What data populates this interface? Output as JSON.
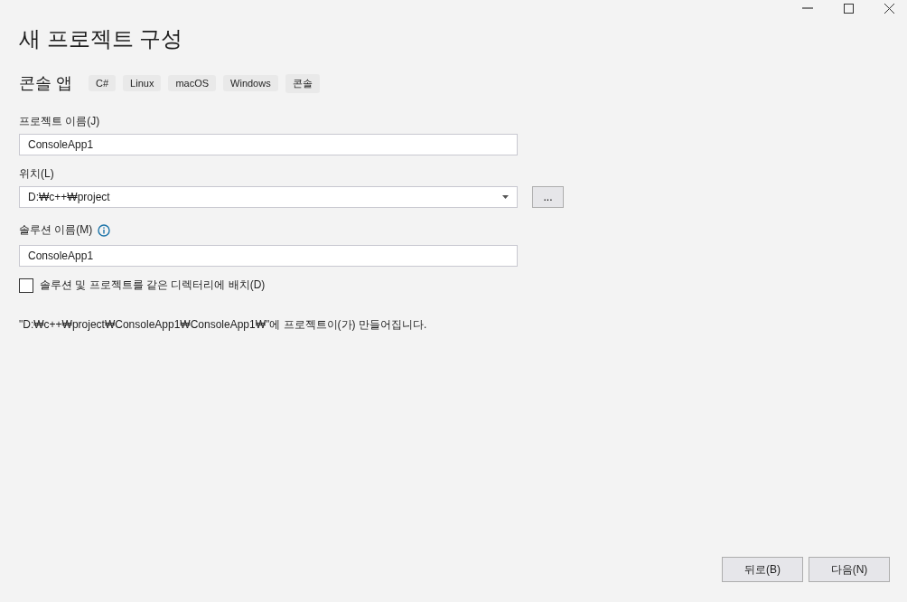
{
  "title": "새 프로젝트 구성",
  "template": {
    "name": "콘솔 앱",
    "tags": [
      "C#",
      "Linux",
      "macOS",
      "Windows",
      "콘솔"
    ]
  },
  "project_name": {
    "label": "프로젝트 이름(J)",
    "value": "ConsoleApp1"
  },
  "location": {
    "label": "위치(L)",
    "value": "D:₩c++₩project",
    "browse": "..."
  },
  "solution_name": {
    "label": "솔루션 이름(M)",
    "value": "ConsoleApp1"
  },
  "same_directory": {
    "label": "솔루션 및 프로젝트를 같은 디렉터리에 배치(D)",
    "checked": false
  },
  "path_note": "\"D:₩c++₩project₩ConsoleApp1₩ConsoleApp1₩\"에 프로젝트이(가) 만들어집니다.",
  "buttons": [
    "뒤로(B)",
    "다음(N)"
  ]
}
